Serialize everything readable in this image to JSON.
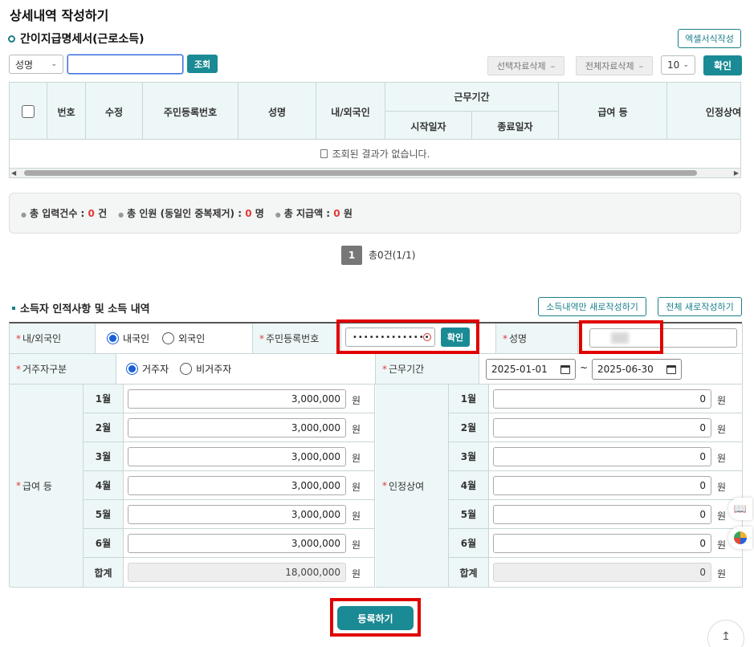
{
  "page_title": "상세내역 작성하기",
  "section_title": "간이지급명세서(근로소득)",
  "excel_button": "엑셀서식작성",
  "search": {
    "field_select": "성명",
    "query_value": "",
    "search_button": "조회"
  },
  "toolbar": {
    "delete_selected": "선택자료삭제",
    "delete_all": "전체자료삭제",
    "page_size": "10",
    "confirm": "확인"
  },
  "table": {
    "headers": {
      "no": "번호",
      "edit": "수정",
      "rrn": "주민등록번호",
      "name": "성명",
      "nationality": "내/외국인",
      "work_period": "근무기간",
      "start": "시작일자",
      "end": "종료일자",
      "salary": "급여 등",
      "bonus": "인정상여"
    },
    "empty_message": "조회된 결과가 없습니다."
  },
  "summary": {
    "count_label": "총 입력건수 :",
    "count_value": "0",
    "count_unit": "건",
    "people_label": "총 인원 (동일인 중복제거) :",
    "people_value": "0",
    "people_unit": "명",
    "amount_label": "총 지급액 :",
    "amount_value": "0",
    "amount_unit": "원"
  },
  "pagination": {
    "current_page": "1",
    "total_text": "총0건(1/1)"
  },
  "form": {
    "title": "소득자 인적사항 및 소득 내역",
    "new_income_button": "소득내역만 새로작성하기",
    "new_all_button": "전체 새로작성하기",
    "nationality_label": "내/외국인",
    "domestic": "내국인",
    "foreign": "외국인",
    "rrn_label": "주민등록번호",
    "rrn_value": "••••••••••••••",
    "rrn_confirm": "확인",
    "name_label": "성명",
    "residency_label": "거주자구분",
    "resident": "거주자",
    "nonresident": "비거주자",
    "period_label": "근무기간",
    "start_date": "2025-01-01",
    "tilde": "~",
    "end_date": "2025-06-30",
    "salary_label": "급여 등",
    "bonus_label": "인정상여",
    "won": "원",
    "total_label": "합계",
    "salary_rows": [
      {
        "month": "1월",
        "amount": "3,000,000"
      },
      {
        "month": "2월",
        "amount": "3,000,000"
      },
      {
        "month": "3월",
        "amount": "3,000,000"
      },
      {
        "month": "4월",
        "amount": "3,000,000"
      },
      {
        "month": "5월",
        "amount": "3,000,000"
      },
      {
        "month": "6월",
        "amount": "3,000,000"
      }
    ],
    "salary_total": "18,000,000",
    "bonus_rows": [
      {
        "month": "1월",
        "amount": "0"
      },
      {
        "month": "2월",
        "amount": "0"
      },
      {
        "month": "3월",
        "amount": "0"
      },
      {
        "month": "4월",
        "amount": "0"
      },
      {
        "month": "5월",
        "amount": "0"
      },
      {
        "month": "6월",
        "amount": "0"
      }
    ],
    "bonus_total": "0",
    "submit_button": "등록하기"
  }
}
